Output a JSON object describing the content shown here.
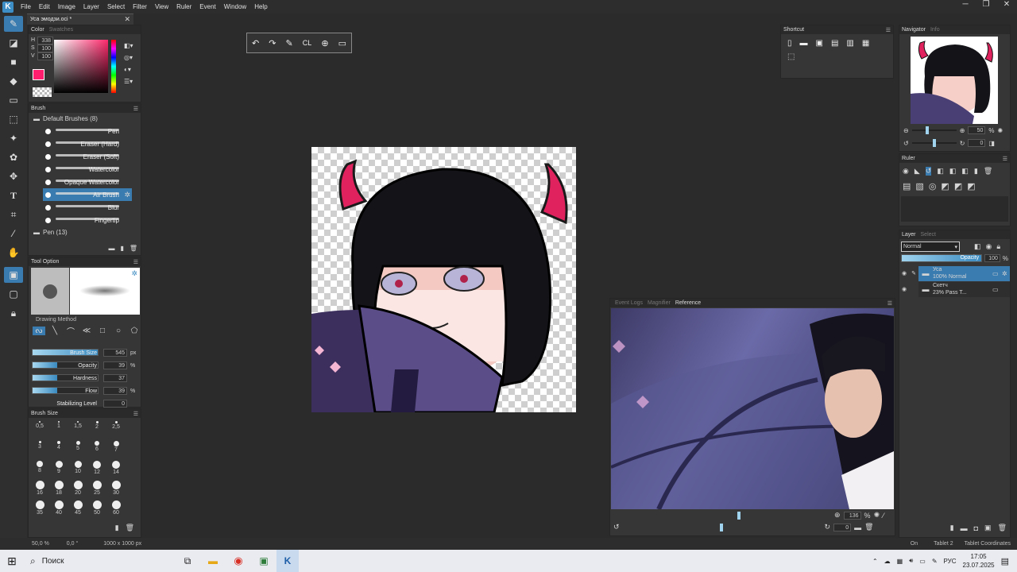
{
  "app": {
    "menu": [
      "File",
      "Edit",
      "Image",
      "Layer",
      "Select",
      "Filter",
      "View",
      "Ruler",
      "Event",
      "Window",
      "Help"
    ],
    "doc_tab": "Уса эмодзи.oci *"
  },
  "color_panel": {
    "tabs": [
      "Color",
      "Swatches"
    ],
    "h": "338",
    "s": "100",
    "v": "100"
  },
  "brush_panel": {
    "title": "Brush",
    "group": "Default Brushes (8)",
    "items": [
      "Pen",
      "Eraser (Hard)",
      "Eraser (Soft)",
      "Watercolor",
      "Opaque Watercolor",
      "Air Brush",
      "Blur",
      "Fingertip"
    ],
    "selected": 5,
    "group2": "Pen (13)"
  },
  "tool_option": {
    "title": "Tool Option",
    "drawing_method": "Drawing Method",
    "params": [
      {
        "label": "Brush Size",
        "value": "545",
        "unit": "px"
      },
      {
        "label": "Opacity",
        "value": "39",
        "unit": "%"
      },
      {
        "label": "Hardness",
        "value": "37",
        "unit": ""
      },
      {
        "label": "Flow",
        "value": "39",
        "unit": "%"
      },
      {
        "label": "Stabilizing Level",
        "value": "0",
        "unit": ""
      }
    ]
  },
  "brush_size": {
    "title": "Brush Size",
    "sizes": [
      "0,5",
      "1",
      "1,5",
      "2",
      "2,5",
      "3",
      "4",
      "5",
      "6",
      "7",
      "8",
      "9",
      "10",
      "12",
      "14",
      "16",
      "18",
      "20",
      "25",
      "30",
      "35",
      "40",
      "45",
      "50",
      "60"
    ]
  },
  "shortcut": {
    "title": "Shortcut"
  },
  "navigator": {
    "tabs": [
      "Navigator",
      "Info"
    ],
    "zoom": "50",
    "zoom_unit": "%",
    "rotation": "0"
  },
  "ruler": {
    "title": "Ruler"
  },
  "layer": {
    "tabs": [
      "Layer",
      "Select"
    ],
    "blend": "Normal",
    "opacity_label": "Opacity",
    "opacity": "100",
    "opacity_unit": "%",
    "layers": [
      {
        "name": "Уса",
        "mode": "100% Normal"
      },
      {
        "name": "Скетч",
        "mode": "23% Pass T..."
      }
    ]
  },
  "reference": {
    "tabs": [
      "Event Logs",
      "Magnifier",
      "Reference"
    ],
    "zoom": "136",
    "zoom_unit": "%",
    "rotation": "0"
  },
  "status": {
    "zoom": "50,0 %",
    "angle": "0,0 °",
    "size": "1000 x 1000 px",
    "on": "On",
    "tablet": "Tablet 2",
    "coords": "Tablet Coordinates"
  },
  "taskbar": {
    "search": "Поиск",
    "lang": "РУС",
    "time": "17:05",
    "date": "23.07.2025"
  },
  "colors": {
    "accent": "#3a7cb0",
    "primary": "#ff1e6e"
  }
}
